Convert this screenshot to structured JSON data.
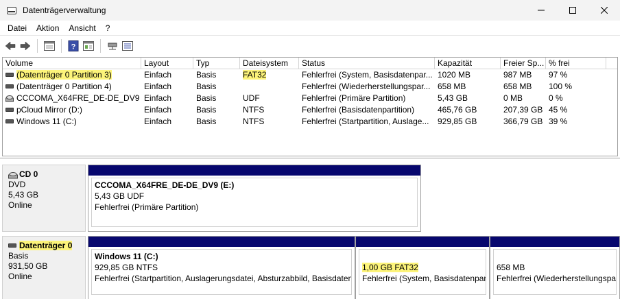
{
  "window": {
    "title": "Datenträgerverwaltung"
  },
  "menu": [
    "Datei",
    "Aktion",
    "Ansicht",
    "?"
  ],
  "toolbar": [
    "back-icon",
    "forward-icon",
    "properties-icon",
    "help-icon",
    "view-icon",
    "connect-icon",
    "settings-icon"
  ],
  "list": {
    "columns": [
      "Volume",
      "Layout",
      "Typ",
      "Dateisystem",
      "Status",
      "Kapazität",
      "Freier Sp...",
      "% frei"
    ],
    "rows": [
      {
        "volume": "(Datenträger 0 Partition 3)",
        "layout": "Einfach",
        "typ": "Basis",
        "fs": "FAT32",
        "status": "Fehlerfrei (System, Basisdatenpar...",
        "kap": "1020 MB",
        "frei": "987 MB",
        "pct": "97 %"
      },
      {
        "volume": "(Datenträger 0 Partition 4)",
        "layout": "Einfach",
        "typ": "Basis",
        "fs": "",
        "status": "Fehlerfrei (Wiederherstellungspar...",
        "kap": "658 MB",
        "frei": "658 MB",
        "pct": "100 %"
      },
      {
        "volume": "CCCOMA_X64FRE_DE-DE_DV9 (E:)",
        "layout": "Einfach",
        "typ": "Basis",
        "fs": "UDF",
        "status": "Fehlerfrei (Primäre Partition)",
        "kap": "5,43 GB",
        "frei": "0 MB",
        "pct": "0 %"
      },
      {
        "volume": "pCloud Mirror (D:)",
        "layout": "Einfach",
        "typ": "Basis",
        "fs": "NTFS",
        "status": "Fehlerfrei (Basisdatenpartition)",
        "kap": "465,76 GB",
        "frei": "207,39 GB",
        "pct": "45 %"
      },
      {
        "volume": "Windows 11 (C:)",
        "layout": "Einfach",
        "typ": "Basis",
        "fs": "NTFS",
        "status": "Fehlerfrei (Startpartition, Auslage...",
        "kap": "929,85 GB",
        "frei": "366,79 GB",
        "pct": "39 %"
      }
    ]
  },
  "disks": {
    "cd0": {
      "name": "CD 0",
      "type": "DVD",
      "size": "5,43 GB",
      "state": "Online",
      "partition": {
        "name": "CCCOMA_X64FRE_DE-DE_DV9  (E:)",
        "line2": "5,43 GB UDF",
        "line3": "Fehlerfrei (Primäre Partition)"
      }
    },
    "disk0": {
      "name": "Datenträger 0",
      "type": "Basis",
      "size": "931,50 GB",
      "state": "Online",
      "partitions": [
        {
          "name": "Windows 11  (C:)",
          "line2": "929,85 GB NTFS",
          "line3": "Fehlerfrei (Startpartition, Auslagerungsdatei, Absturzabbild, Basisdatenpa"
        },
        {
          "name": "",
          "line2": "1,00 GB FAT32",
          "line3": "Fehlerfrei (System, Basisdatenparti"
        },
        {
          "name": "",
          "line2": "658 MB",
          "line3": "Fehlerfrei (Wiederherstellungspa"
        }
      ]
    }
  },
  "colors": {
    "partition_bar": "#07076e",
    "highlight": "#fdf47a"
  }
}
